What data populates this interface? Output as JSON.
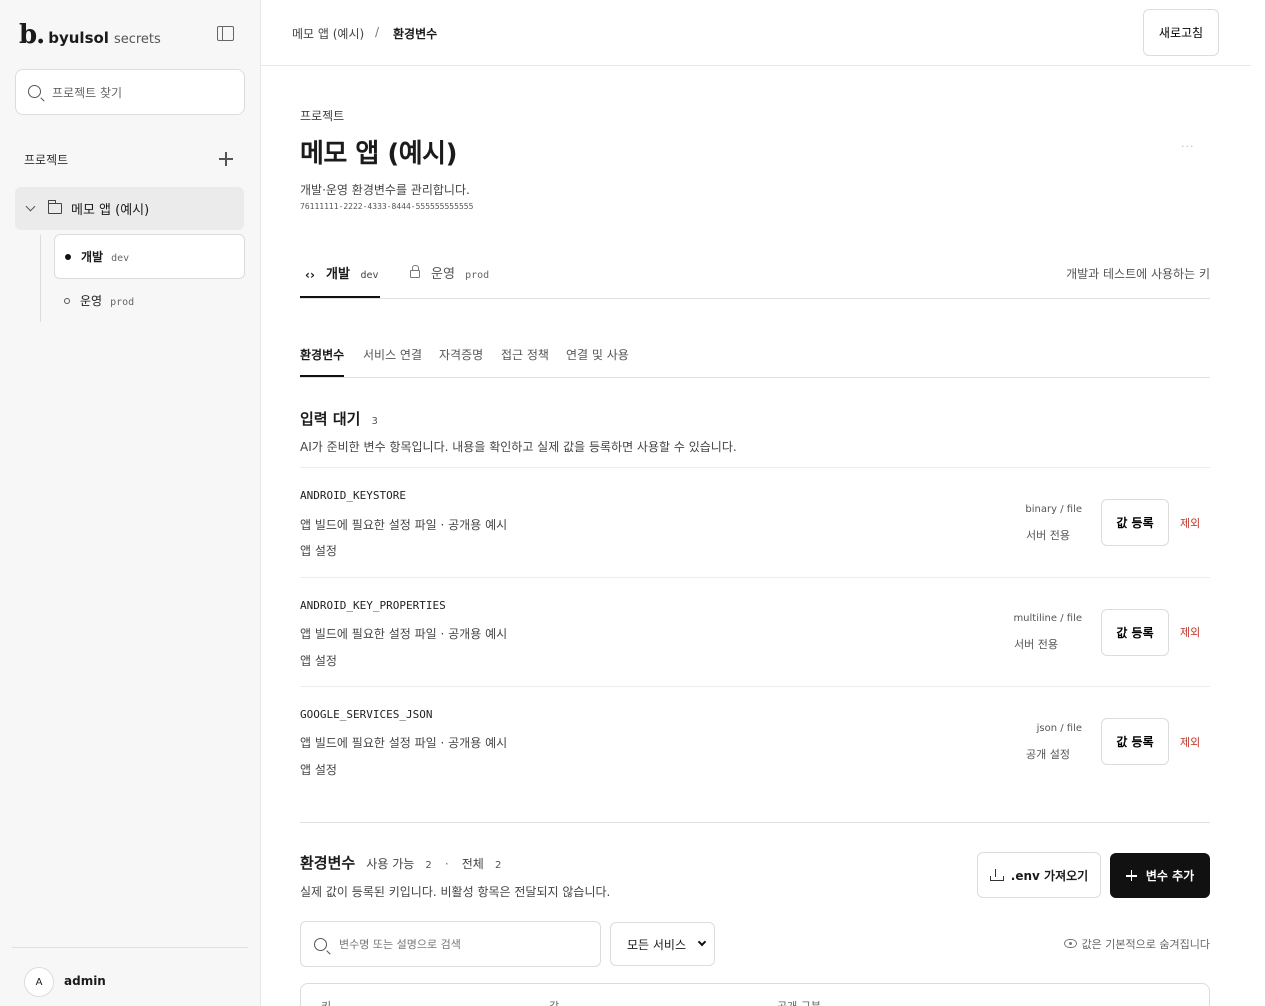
{
  "app": {
    "brand_mark": "b.",
    "brand_name": "byulsol",
    "brand_sub": "secrets"
  },
  "sidebar": {
    "search_placeholder": "프로젝트 찾기",
    "section_label": "프로젝트",
    "project": {
      "label": "메모 앱 (예시)"
    },
    "envs": [
      {
        "name": "개발",
        "code": "dev",
        "active": true
      },
      {
        "name": "운영",
        "code": "prod",
        "active": false
      }
    ],
    "user": {
      "avatar": "A",
      "name": "admin"
    }
  },
  "header": {
    "breadcrumb": [
      "메모 앱 (예시)",
      "환경변수"
    ],
    "separator": "/",
    "refresh_label": "새로고침"
  },
  "project": {
    "eyebrow": "프로젝트",
    "title": "메모 앱 (예시)",
    "description": "개발·운영 환경변수를 관리합니다.",
    "id": "76111111-2222-4333-8444-555555555555",
    "more": "···"
  },
  "env_tabs": {
    "items": [
      {
        "icon": "code-icon",
        "name": "개발",
        "code": "dev",
        "active": true
      },
      {
        "icon": "lock-icon",
        "name": "운영",
        "code": "prod",
        "active": false
      }
    ],
    "hint": "개발과 테스트에 사용하는 키"
  },
  "section_tabs": [
    "환경변수",
    "서비스 연결",
    "자격증명",
    "접근 정책",
    "연결 및 사용"
  ],
  "pending": {
    "title": "입력 대기",
    "count": "3",
    "description": "AI가 준비한 변수 항목입니다. 내용을 확인하고 실제 값을 등록하면 사용할 수 있습니다.",
    "items": [
      {
        "key": "ANDROID_KEYSTORE",
        "desc": "앱 빌드에 필요한 설정 파일 · 공개용 예시",
        "group": "앱 설정",
        "type": "binary / file",
        "scope": "서버 전용",
        "register": "값 등록",
        "remove": "제외"
      },
      {
        "key": "ANDROID_KEY_PROPERTIES",
        "desc": "앱 빌드에 필요한 설정 파일 · 공개용 예시",
        "group": "앱 설정",
        "type": "multiline / file",
        "scope": "서버 전용",
        "register": "값 등록",
        "remove": "제외"
      },
      {
        "key": "GOOGLE_SERVICES_JSON",
        "desc": "앱 빌드에 필요한 설정 파일 · 공개용 예시",
        "group": "앱 설정",
        "type": "json / file",
        "scope": "공개 설정",
        "register": "값 등록",
        "remove": "제외"
      }
    ]
  },
  "variables": {
    "title": "환경변수",
    "usable_label": "사용 가능",
    "usable_count": "2",
    "dot": "·",
    "total_label": "전체",
    "total_count": "2",
    "description": "실제 값이 등록된 키입니다. 비활성 항목은 전달되지 않습니다.",
    "import_label": ".env 가져오기",
    "add_label": "변수 추가",
    "search_placeholder": "변수명 또는 설명으로 검색",
    "service_filter": "모든 서비스",
    "hidden_hint": "값은 기본적으로 숨겨집니다",
    "columns": [
      "키",
      "값",
      "공개 구분"
    ]
  }
}
